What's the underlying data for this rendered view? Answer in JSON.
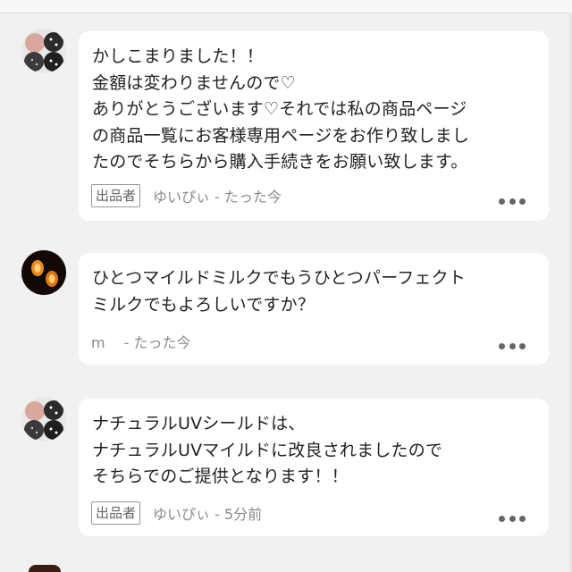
{
  "comments": [
    {
      "text": "かしこまりました！！\n金額は変わりませんので♡\nありがとうございます♡それでは私の商品ページ\nの商品一覧にお客様専用ページをお作り致しまし\nたのでそちらから購入手続きをお願い致します。",
      "badge": "出品者",
      "meta": "ゆいぴぃ - たった今"
    },
    {
      "text": "ひとつマイルドミルクでもうひとつパーフェクト\nミルクでもよろしいですか？",
      "badge": "",
      "meta": "m　 - たった今"
    },
    {
      "text": "ナチュラルUVシールドは、\nナチュラルUVマイルドに改良されましたので\nそちらでのご提供となります！！",
      "badge": "出品者",
      "meta": "ゆいぴぃ - 5分前"
    }
  ],
  "icons": {
    "more": "more-dots-icon"
  }
}
